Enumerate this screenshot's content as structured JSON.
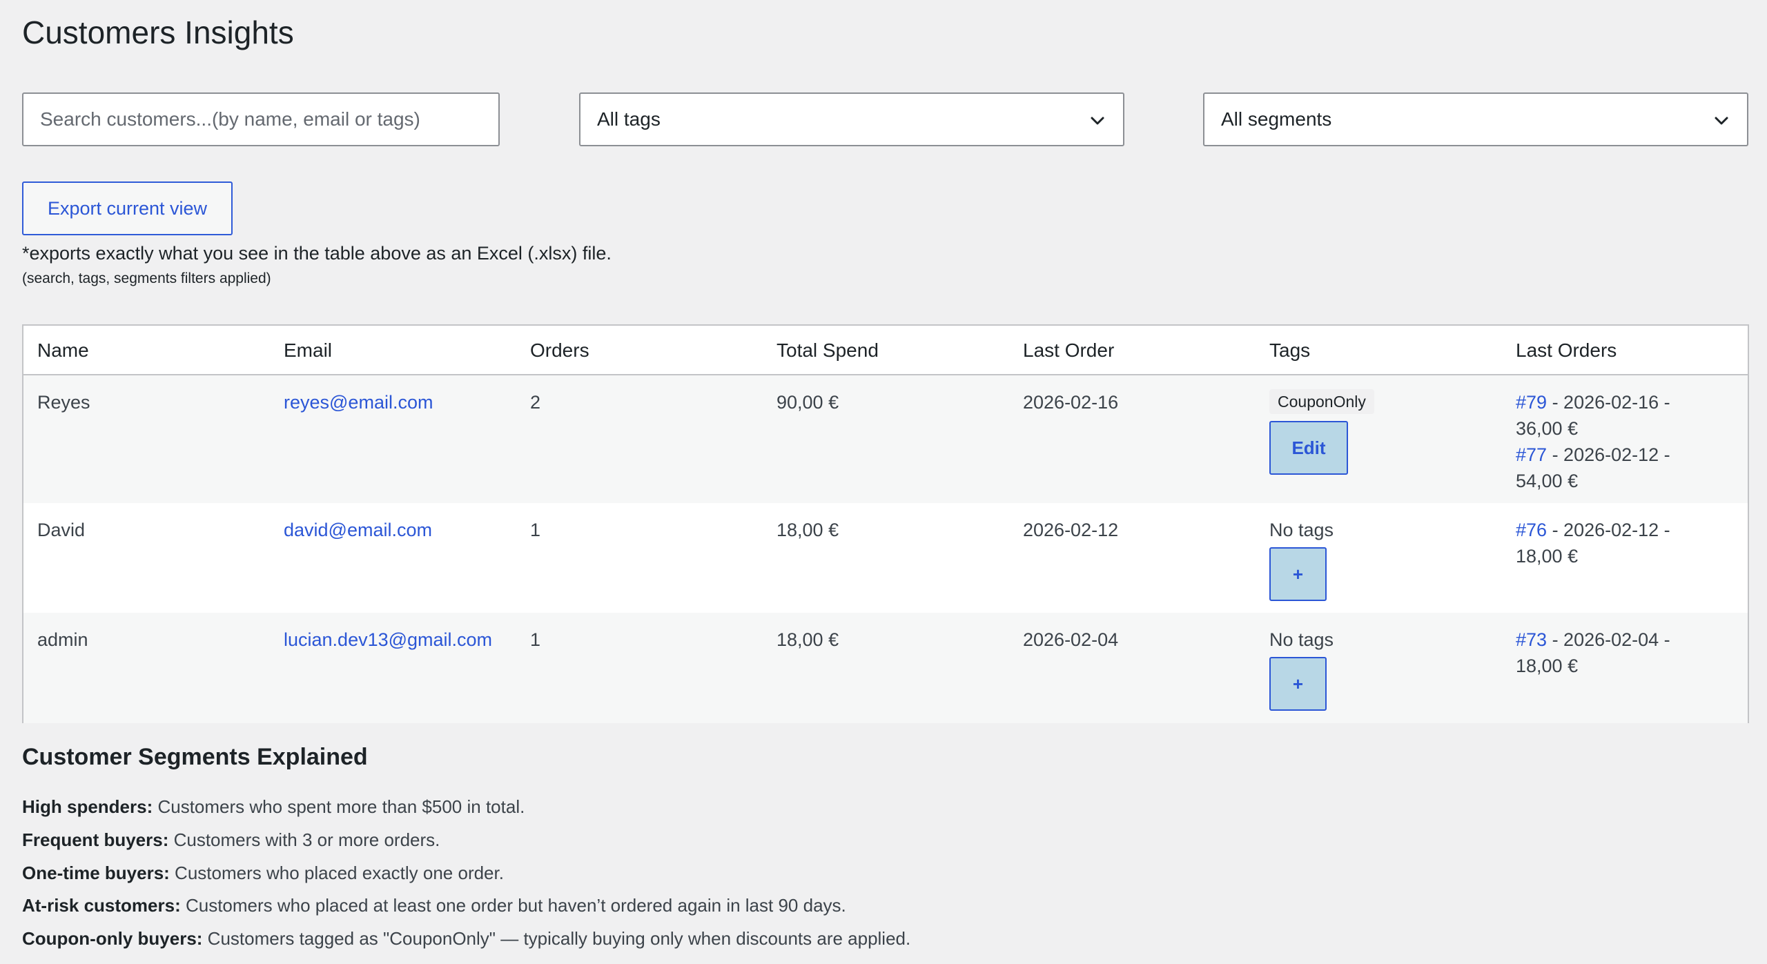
{
  "page": {
    "title": "Customers Insights"
  },
  "filters": {
    "search_placeholder": "Search customers...(by name, email or tags)",
    "tags_selected": "All tags",
    "segments_selected": "All segments"
  },
  "export": {
    "button_label": "Export current view",
    "note": "*exports exactly what you see in the table above as an Excel (.xlsx) file.",
    "subnote": "(search, tags, segments filters applied)"
  },
  "table": {
    "headers": {
      "name": "Name",
      "email": "Email",
      "orders": "Orders",
      "total_spend": "Total Spend",
      "last_order": "Last Order",
      "tags": "Tags",
      "last_orders": "Last Orders"
    },
    "rows": [
      {
        "name": "Reyes",
        "email": "reyes@email.com",
        "orders": "2",
        "total_spend": "90,00 €",
        "last_order": "2026-02-16",
        "tag": "CouponOnly",
        "tag_button": "Edit",
        "last_orders": [
          {
            "id": "#79",
            "line1": " - 2026-02-16 -",
            "line2": "36,00 €"
          },
          {
            "id": "#77",
            "line1": " - 2026-02-12 -",
            "line2": "54,00 €"
          }
        ]
      },
      {
        "name": "David",
        "email": "david@email.com",
        "orders": "1",
        "total_spend": "18,00 €",
        "last_order": "2026-02-12",
        "tag": "No tags",
        "tag_button": "+",
        "last_orders": [
          {
            "id": "#76",
            "line1": " - 2026-02-12 -",
            "line2": "18,00 €"
          }
        ]
      },
      {
        "name": "admin",
        "email": "lucian.dev13@gmail.com",
        "orders": "1",
        "total_spend": "18,00 €",
        "last_order": "2026-02-04",
        "tag": "No tags",
        "tag_button": "+",
        "last_orders": [
          {
            "id": "#73",
            "line1": " - 2026-02-04 -",
            "line2": "18,00 €"
          }
        ]
      }
    ]
  },
  "segments": {
    "title": "Customer Segments Explained",
    "items": [
      {
        "term": "High spenders:",
        "desc": " Customers who spent more than $500 in total."
      },
      {
        "term": "Frequent buyers:",
        "desc": " Customers with 3 or more orders."
      },
      {
        "term": "One-time buyers:",
        "desc": " Customers who placed exactly one order."
      },
      {
        "term": "At-risk customers:",
        "desc": " Customers who placed at least one order but haven’t ordered again in last 90 days."
      },
      {
        "term": "Coupon-only buyers:",
        "desc": " Customers tagged as \"CouponOnly\" — typically buying only when discounts are applied."
      }
    ]
  }
}
